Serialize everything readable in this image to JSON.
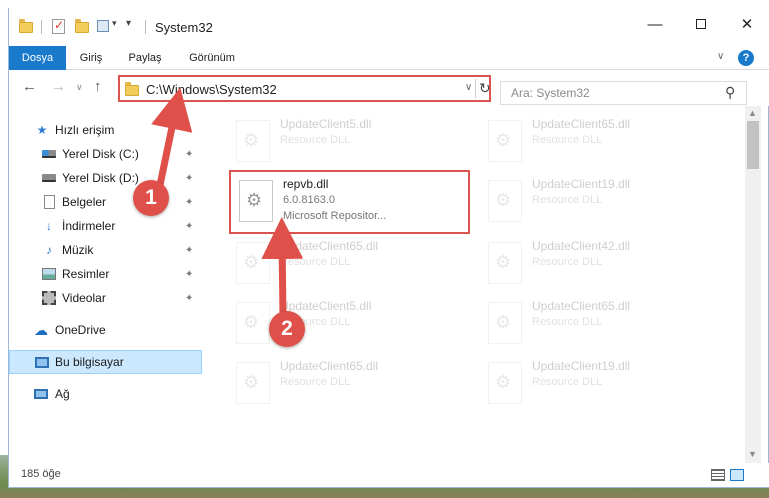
{
  "window": {
    "title": "System32",
    "minimize": "—",
    "close": "✕"
  },
  "ribbon": {
    "tabs": [
      "Dosya",
      "Giriş",
      "Paylaş",
      "Görünüm"
    ],
    "help": "?"
  },
  "nav": {
    "address": "C:\\Windows\\System32",
    "search_placeholder": "Ara: System32"
  },
  "sidebar": {
    "items": [
      {
        "label": "Hızlı erişim",
        "icon": "star-icon"
      },
      {
        "label": "Yerel Disk (C:)",
        "icon": "drive-icon",
        "pinned": true
      },
      {
        "label": "Yerel Disk (D:)",
        "icon": "drive-icon",
        "pinned": true
      },
      {
        "label": "Belgeler",
        "icon": "document-icon",
        "pinned": true
      },
      {
        "label": "İndirmeler",
        "icon": "download-icon",
        "pinned": true
      },
      {
        "label": "Müzik",
        "icon": "music-icon",
        "pinned": true
      },
      {
        "label": "Resimler",
        "icon": "picture-icon",
        "pinned": true
      },
      {
        "label": "Videolar",
        "icon": "video-icon",
        "pinned": true
      },
      {
        "label": "OneDrive",
        "icon": "cloud-icon"
      },
      {
        "label": "Bu bilgisayar",
        "icon": "computer-icon",
        "selected": true
      },
      {
        "label": "Ağ",
        "icon": "network-icon"
      }
    ],
    "pin_glyph": "📌"
  },
  "files": {
    "highlighted": {
      "name": "repvb.dll",
      "version": "6.0.8163.0",
      "company": "Microsoft Repositor..."
    },
    "background": [
      {
        "name": "UpdateClient5.dll",
        "type": "Resource DLL"
      },
      {
        "name": "UpdateClient65.dll",
        "type": "Resource DLL"
      },
      {
        "name": "UpdateClient19.dll",
        "type": "Resource DLL"
      },
      {
        "name": "UpdateClient65.dll",
        "type": "Resource DLL"
      },
      {
        "name": "UpdateClient42.dll",
        "type": "Resource DLL"
      },
      {
        "name": "UpdateClient5.dll",
        "type": "Resource DLL"
      },
      {
        "name": "UpdateClient65.dll",
        "type": "Resource DLL"
      },
      {
        "name": "UpdateClient65.dll",
        "type": "Resource DLL"
      },
      {
        "name": "UpdateClient19.dll",
        "type": "Resource DLL"
      }
    ]
  },
  "status": {
    "item_count": "185 öğe"
  },
  "annotations": {
    "step1": "1",
    "step2": "2",
    "color": "#e0504a"
  },
  "colors": {
    "accent": "#1979ca",
    "highlight_border": "#d9534f",
    "selected_bg": "#cce8ff"
  }
}
